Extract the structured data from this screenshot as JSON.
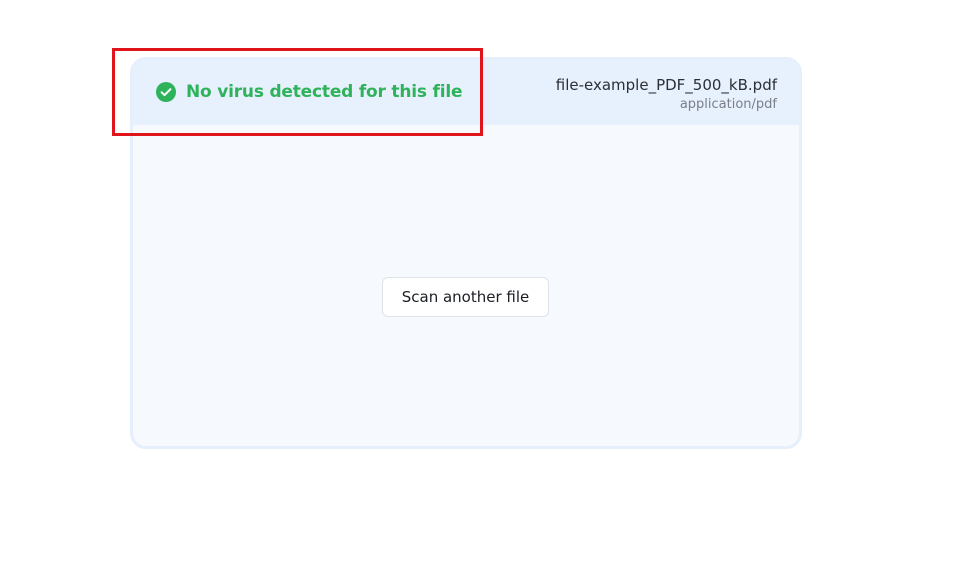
{
  "scan_result": {
    "status_text": "No virus detected for this file",
    "status_icon": "check-circle-icon",
    "status_color": "#2fb35a"
  },
  "file": {
    "name": "file-example_PDF_500_kB.pdf",
    "type": "application/pdf"
  },
  "actions": {
    "scan_another_label": "Scan another file"
  },
  "annotation": {
    "highlight_color": "#e0141b"
  }
}
